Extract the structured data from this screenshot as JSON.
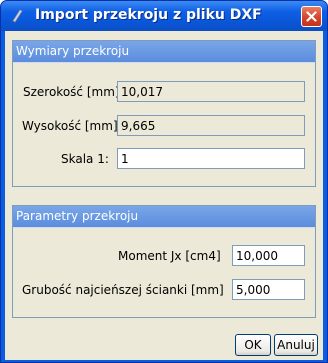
{
  "window": {
    "title": "Import przekroju z pliku DXF",
    "colors": {
      "titlebar": "#0a5de0",
      "panel_header": "#5b8ddd",
      "close": "#d6442b",
      "client": "#ece9d8"
    }
  },
  "dimensions": {
    "header": "Wymiary przekroju",
    "width_label": "Szerokość [mm]",
    "width_value": "10,017",
    "height_label": "Wysokość [mm]",
    "height_value": "9,665",
    "scale_label": "Skala 1:",
    "scale_value": "1"
  },
  "params": {
    "header": "Parametry przekroju",
    "moment_label": "Moment Jx [cm4]",
    "moment_value": "10,000",
    "thickness_label": "Grubość najcieńszej ścianki [mm]",
    "thickness_value": "5,000"
  },
  "buttons": {
    "ok": "OK",
    "cancel": "Anuluj"
  },
  "icons": {
    "title": "app-icon",
    "close": "close-icon"
  }
}
